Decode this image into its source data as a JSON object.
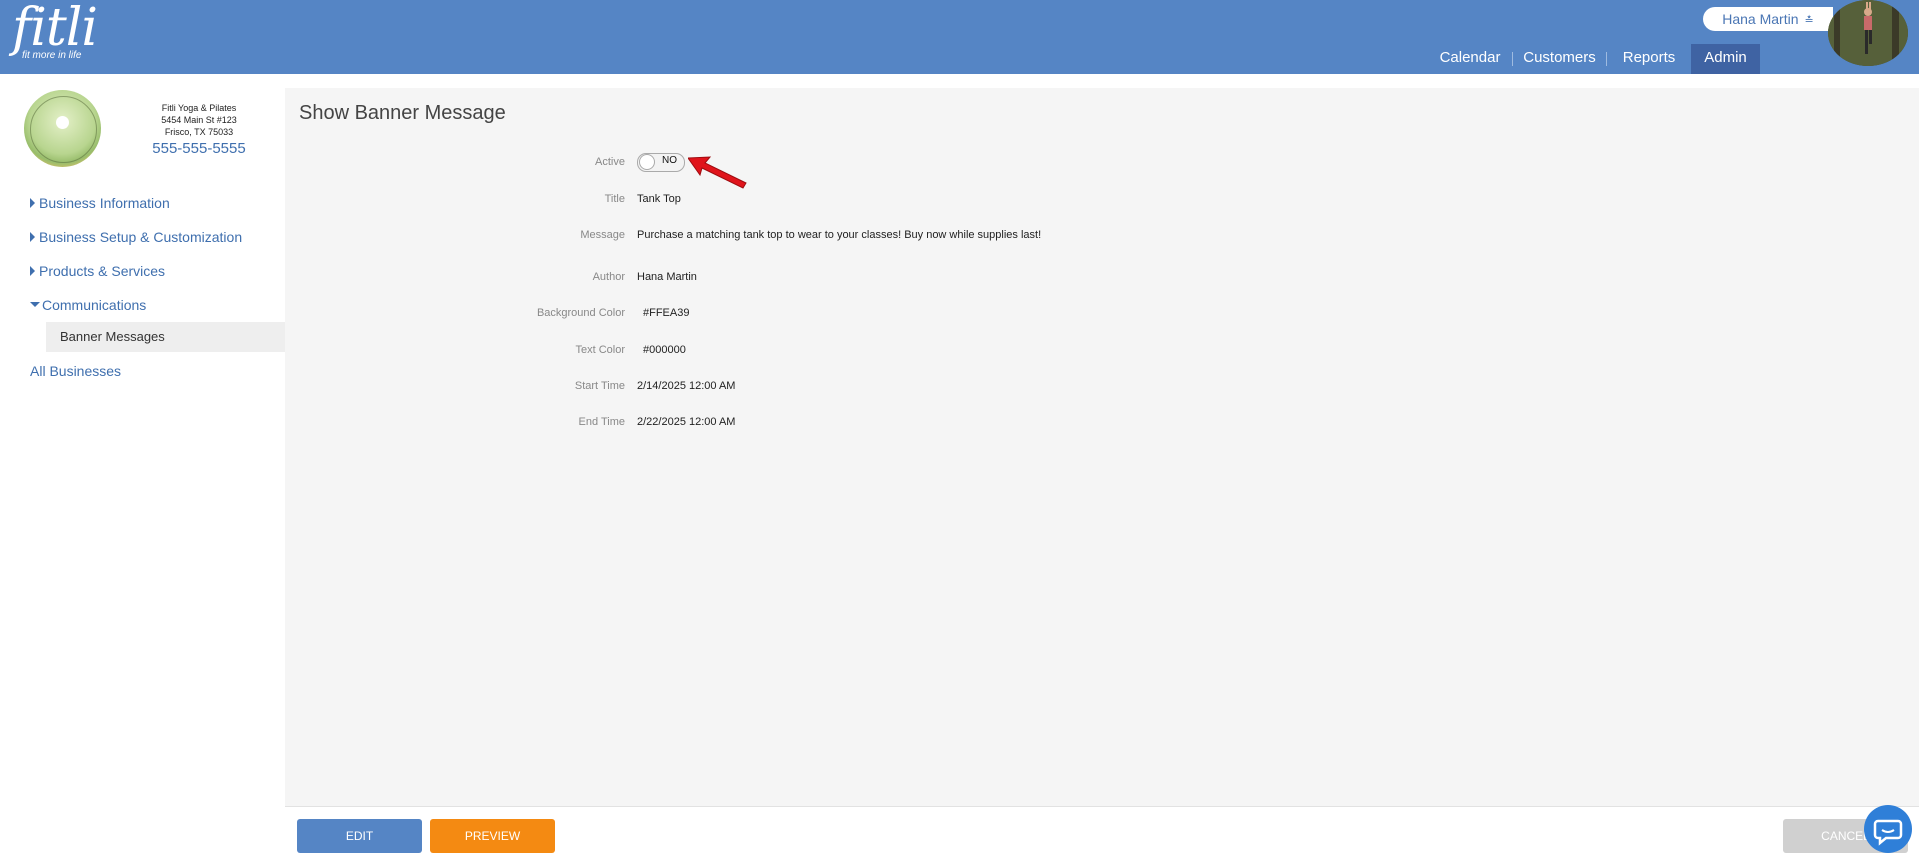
{
  "header": {
    "logo_word": "fitli",
    "logo_tagline": "fit more in life",
    "user_name": "Hana Martin",
    "user_menu_icon": "double-chevron-down-icon",
    "nav": [
      {
        "label": "Calendar",
        "active": false
      },
      {
        "label": "Customers",
        "active": false
      },
      {
        "label": "Reports",
        "active": false
      },
      {
        "label": "Admin",
        "active": true
      }
    ]
  },
  "sidebar": {
    "business_name": "Fitli Yoga & Pilates",
    "address_line1": "5454 Main St #123",
    "address_line2": "Frisco, TX 75033",
    "phone": "555-555-5555",
    "menu": [
      {
        "label": "Business Information",
        "expanded": false
      },
      {
        "label": "Business Setup & Customization",
        "expanded": false
      },
      {
        "label": "Products & Services",
        "expanded": false
      },
      {
        "label": "Communications",
        "expanded": true
      }
    ],
    "submenu_active": "Banner Messages",
    "all_businesses": "All Businesses"
  },
  "main": {
    "title": "Show Banner Message",
    "fields": {
      "active": {
        "label": "Active",
        "value": "NO"
      },
      "title": {
        "label": "Title",
        "value": "Tank Top"
      },
      "message": {
        "label": "Message",
        "value": "Purchase a matching tank top to wear to your classes! Buy now while supplies last!"
      },
      "author": {
        "label": "Author",
        "value": "Hana Martin"
      },
      "background_color": {
        "label": "Background Color",
        "value": "#FFEA39"
      },
      "text_color": {
        "label": "Text Color",
        "value": "#000000"
      },
      "start_time": {
        "label": "Start Time",
        "value": "2/14/2025 12:00 AM"
      },
      "end_time": {
        "label": "End Time",
        "value": "2/22/2025 12:00 AM"
      }
    }
  },
  "buttons": {
    "edit": "EDIT",
    "preview": "PREVIEW",
    "cancel": "CANCEL"
  },
  "colors": {
    "brand_blue": "#5585c5",
    "nav_active": "#3f63a3",
    "preview_orange": "#f48a12",
    "link_blue": "#3f6fae",
    "annotation_arrow": "#e0141b"
  }
}
